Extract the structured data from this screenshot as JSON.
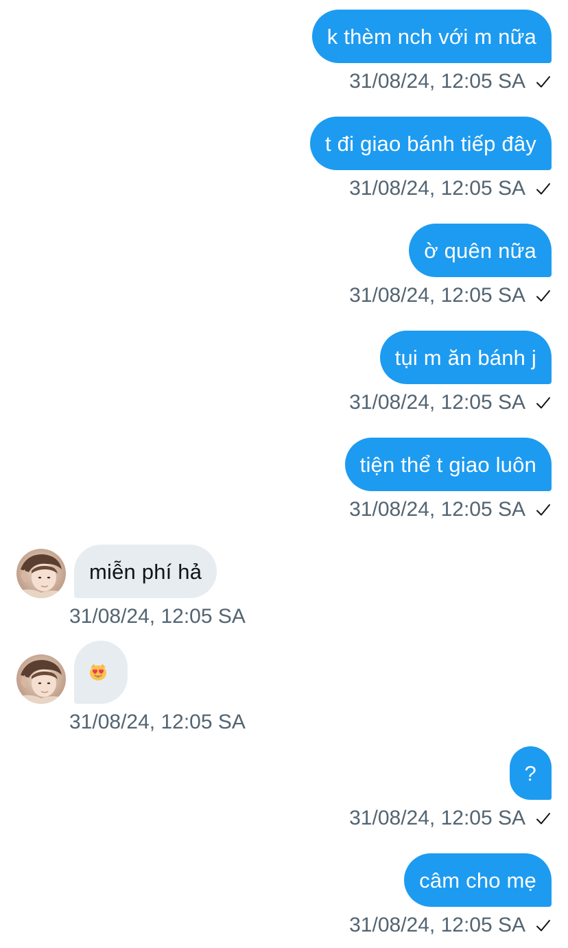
{
  "messages": [
    {
      "direction": "sent",
      "text": "k thèm nch với m nữa",
      "timestamp": "31/08/24, 12:05 SA",
      "status_icon": "check-icon"
    },
    {
      "direction": "sent",
      "text": "t đi giao bánh tiếp đây",
      "timestamp": "31/08/24, 12:05 SA",
      "status_icon": "check-icon"
    },
    {
      "direction": "sent",
      "text": "ờ quên nữa",
      "timestamp": "31/08/24, 12:05 SA",
      "status_icon": "check-icon"
    },
    {
      "direction": "sent",
      "text": "tụi m ăn bánh j",
      "timestamp": "31/08/24, 12:05 SA",
      "status_icon": "check-icon"
    },
    {
      "direction": "sent",
      "text": "tiện thể t giao luôn",
      "timestamp": "31/08/24, 12:05 SA",
      "status_icon": "check-icon"
    },
    {
      "direction": "received",
      "text": "miễn phí hả",
      "timestamp": "31/08/24, 12:05 SA",
      "avatar_icon": "profile-photo"
    },
    {
      "direction": "received",
      "emoji_icon": "heart-eyes-cat-emoji",
      "timestamp": "31/08/24, 12:05 SA",
      "avatar_icon": "profile-photo"
    },
    {
      "direction": "sent",
      "text": "?",
      "timestamp": "31/08/24, 12:05 SA",
      "status_icon": "check-icon"
    },
    {
      "direction": "sent",
      "text": "câm cho mẹ",
      "timestamp": "31/08/24, 12:05 SA",
      "status_icon": "check-icon"
    }
  ],
  "colors": {
    "sent_bubble": "#1d9bf0",
    "sent_text": "#ffffff",
    "received_bubble": "#e7ecf0",
    "received_text": "#0f1419",
    "timestamp": "#536471",
    "background": "#ffffff"
  }
}
